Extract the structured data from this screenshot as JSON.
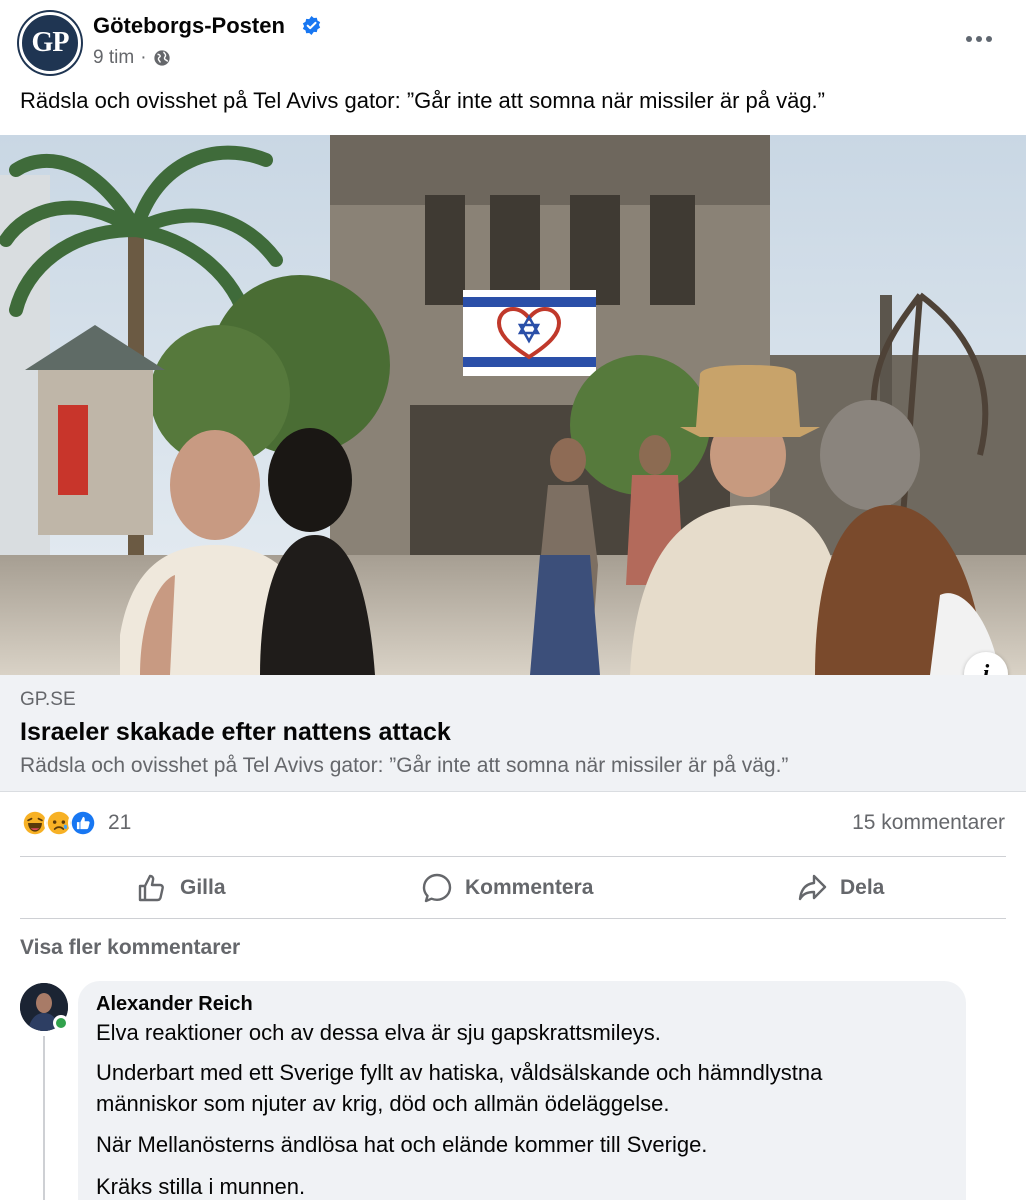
{
  "post": {
    "page_name": "Göteborgs-Posten",
    "avatar_text": "GP",
    "time": "9 tim",
    "separator": "·",
    "text": "Rädsla och ovisshet på Tel Avivs gator: ”Går inte att somna när missiler är på väg.”"
  },
  "link": {
    "domain": "GP.SE",
    "title": "Israeler skakade efter nattens attack",
    "description": "Rädsla och ovisshet på Tel Avivs gator: ”Går inte att somna när missiler är på väg.”"
  },
  "reactions": {
    "icons": [
      "haha-icon",
      "sad-icon",
      "like-icon"
    ],
    "count": "21",
    "comments": "15 kommentarer"
  },
  "actions": {
    "like": "Gilla",
    "comment": "Kommentera",
    "share": "Dela"
  },
  "comments_section": {
    "more_label": "Visa fler kommentarer",
    "comment": {
      "author": "Alexander Reich",
      "lines": [
        "Elva reaktioner och av dessa elva är sju gapskrattsmileys.",
        "Underbart med ett Sverige fyllt av hatiska, våldsälskande och hämndlystna",
        "människor som njuter av krig, död och allmän ödeläggelse.",
        "När Mellanösterns ändlösa hat och elände kommer till Sverige.",
        "Kräks stilla i munnen."
      ]
    }
  },
  "colors": {
    "brand_blue": "#1877f2",
    "secondary_text": "#65676b",
    "link_bg": "#f0f2f5",
    "gp_navy": "#1f3552"
  }
}
